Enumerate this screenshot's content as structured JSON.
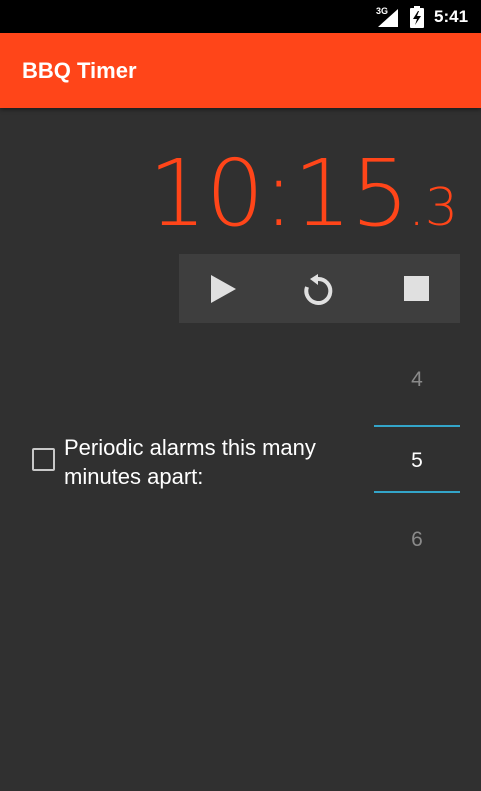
{
  "status_bar": {
    "network": "3G",
    "time": "5:41",
    "icons": [
      "signal-icon",
      "battery-charging-icon"
    ]
  },
  "app_bar": {
    "title": "BBQ Timer",
    "color": "#ff4519"
  },
  "timer": {
    "main": "10:15",
    "fraction": ".3",
    "color": "#ff4519"
  },
  "controls": {
    "buttons": [
      "play-icon",
      "reset-icon",
      "stop-icon"
    ]
  },
  "alarm": {
    "checked": false,
    "label": "Periodic alarms this many minutes apart:"
  },
  "picker": {
    "prev": "4",
    "current": "5",
    "next": "6",
    "accent": "#33a5c9"
  }
}
